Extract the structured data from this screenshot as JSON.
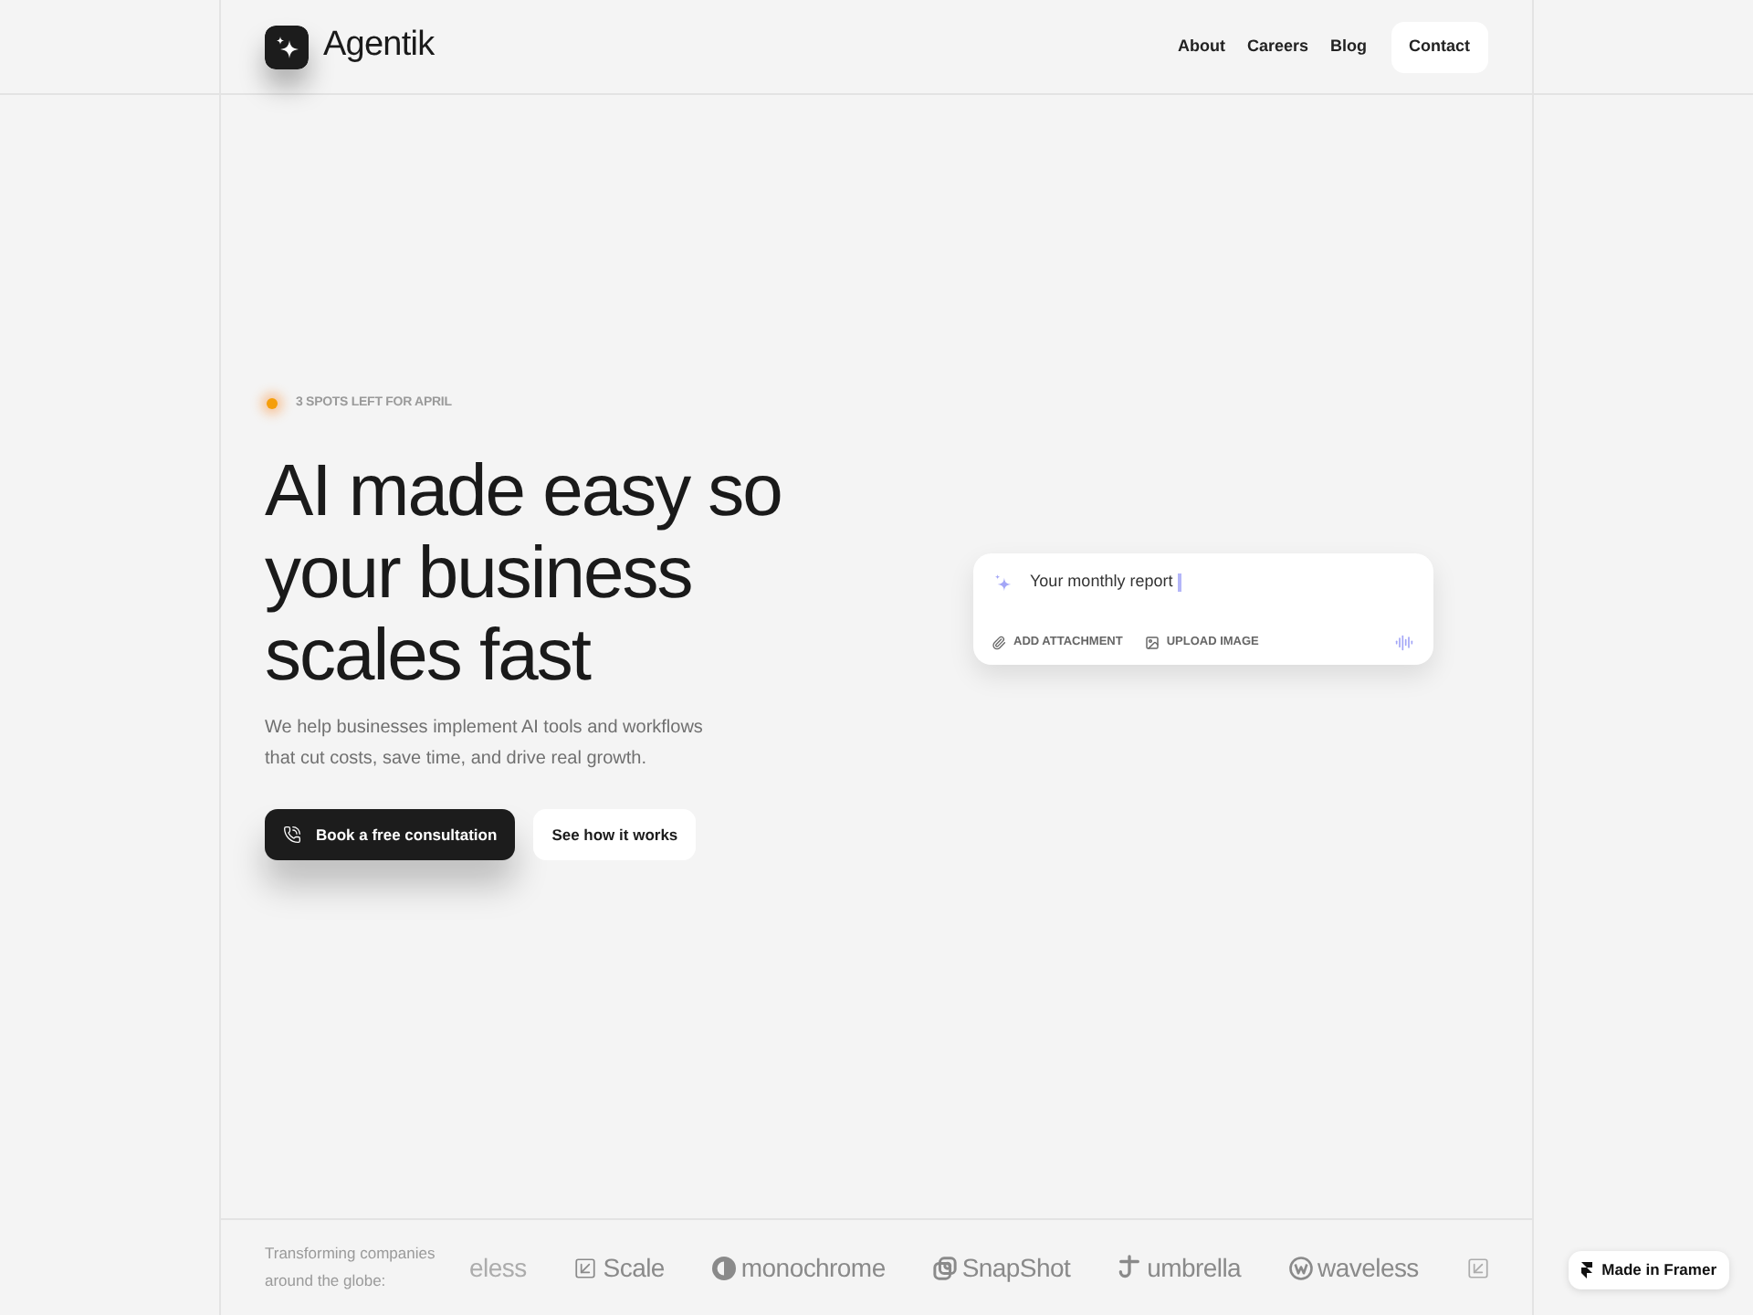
{
  "header": {
    "brand": "Agentik",
    "nav": [
      {
        "label": "About"
      },
      {
        "label": "Careers"
      },
      {
        "label": "Blog"
      }
    ],
    "cta": "Contact"
  },
  "hero": {
    "badge": "3 SPOTS LEFT FOR APRIL",
    "headline": [
      "AI made easy so",
      "your business",
      "scales fast"
    ],
    "description": [
      "We help businesses implement AI tools and workflows",
      "that cut costs, save time, and drive real growth."
    ],
    "buttons": [
      {
        "label": "Book a free consultation",
        "kind": "primary"
      },
      {
        "label": "See how it works",
        "kind": "secondary"
      }
    ]
  },
  "prompt_card": {
    "value": "Your monthly report",
    "actions": [
      {
        "label": "ADD ATTACHMENT",
        "kind": "attachment"
      },
      {
        "label": "UPLOAD IMAGE",
        "kind": "image"
      }
    ]
  },
  "logos_strip": {
    "caption": [
      "Transforming companies",
      "around the globe:"
    ],
    "logos": [
      {
        "name": "eless",
        "kind": "wordmark",
        "faded": true
      },
      {
        "name": "Scale",
        "kind": "scale",
        "faded": false
      },
      {
        "name": "monochrome",
        "kind": "monochrome",
        "faded": false
      },
      {
        "name": "SnapShot",
        "kind": "snapshot",
        "faded": false
      },
      {
        "name": "umbrella",
        "kind": "umbrella",
        "faded": false
      },
      {
        "name": "waveless",
        "kind": "waveless",
        "faded": false
      },
      {
        "kind": "scale",
        "faded": true
      }
    ]
  },
  "framer_badge": {
    "label": "Made in Framer"
  }
}
